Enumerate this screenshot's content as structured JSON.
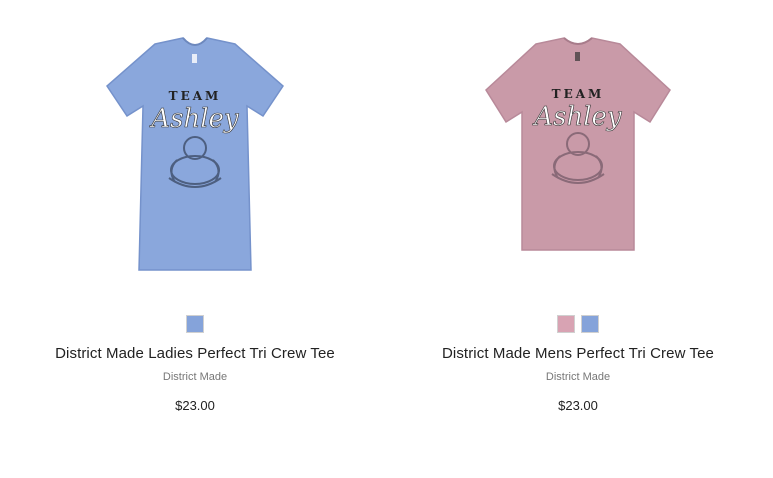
{
  "products": [
    {
      "title": "District Made Ladies Perfect Tri Crew Tee",
      "brand": "District Made",
      "price": "$23.00",
      "shirt_color": "#8aa7dc",
      "shirt_shadow": "#7592cb",
      "print_team": "TEAM",
      "print_name": "Ashley",
      "image_icon": "tshirt-icon",
      "swatches": [
        {
          "color": "#85a3da",
          "label": "blue"
        }
      ]
    },
    {
      "title": "District Made Mens Perfect Tri Crew Tee",
      "brand": "District Made",
      "price": "$23.00",
      "shirt_color": "#c99aa8",
      "shirt_shadow": "#b88999",
      "print_team": "TEAM",
      "print_name": "Ashley",
      "image_icon": "tshirt-icon",
      "swatches": [
        {
          "color": "#d8a3b3",
          "label": "pink"
        },
        {
          "color": "#85a3da",
          "label": "blue"
        }
      ]
    }
  ]
}
